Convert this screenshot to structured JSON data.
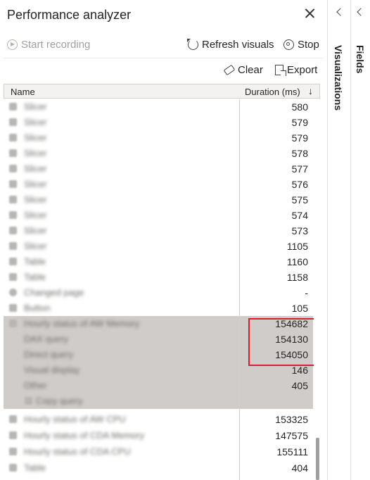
{
  "panel": {
    "title": "Performance analyzer",
    "start_recording": "Start recording",
    "refresh_visuals": "Refresh visuals",
    "stop": "Stop",
    "clear": "Clear",
    "export": "Export"
  },
  "table": {
    "col_name": "Name",
    "col_duration": "Duration (ms)",
    "sort_indicator": "↓",
    "rows": [
      {
        "name": "Slicer",
        "value": "580"
      },
      {
        "name": "Slicer",
        "value": "579"
      },
      {
        "name": "Slicer",
        "value": "579"
      },
      {
        "name": "Slicer",
        "value": "578"
      },
      {
        "name": "Slicer",
        "value": "577"
      },
      {
        "name": "Slicer",
        "value": "576"
      },
      {
        "name": "Slicer",
        "value": "575"
      },
      {
        "name": "Slicer",
        "value": "574"
      },
      {
        "name": "Slicer",
        "value": "573"
      },
      {
        "name": "Slicer",
        "value": "1105"
      },
      {
        "name": "Table",
        "value": "1160"
      },
      {
        "name": "Table",
        "value": "1158"
      },
      {
        "name": "Changed page",
        "value": "-"
      },
      {
        "name": "Button",
        "value": "105"
      },
      {
        "name": "Hourly status of AW Memory",
        "value": "154682"
      },
      {
        "name": "DAX query",
        "value": "154130"
      },
      {
        "name": "Direct query",
        "value": "154050"
      },
      {
        "name": "Visual display",
        "value": "146"
      },
      {
        "name": "Other",
        "value": "405"
      },
      {
        "name": "Copy query",
        "value": ""
      },
      {
        "name": "Hourly status of AW CPU",
        "value": "153325"
      },
      {
        "name": "Hourly status of CDA Memory",
        "value": "147575"
      },
      {
        "name": "Hourly status of CDA CPU",
        "value": "155111"
      },
      {
        "name": "Table",
        "value": "404"
      }
    ]
  },
  "side": {
    "visualizations": "Visualizations",
    "fields": "Fields"
  },
  "colors": {
    "highlight_row": "#cfccca",
    "callout_border": "#d7212a"
  }
}
